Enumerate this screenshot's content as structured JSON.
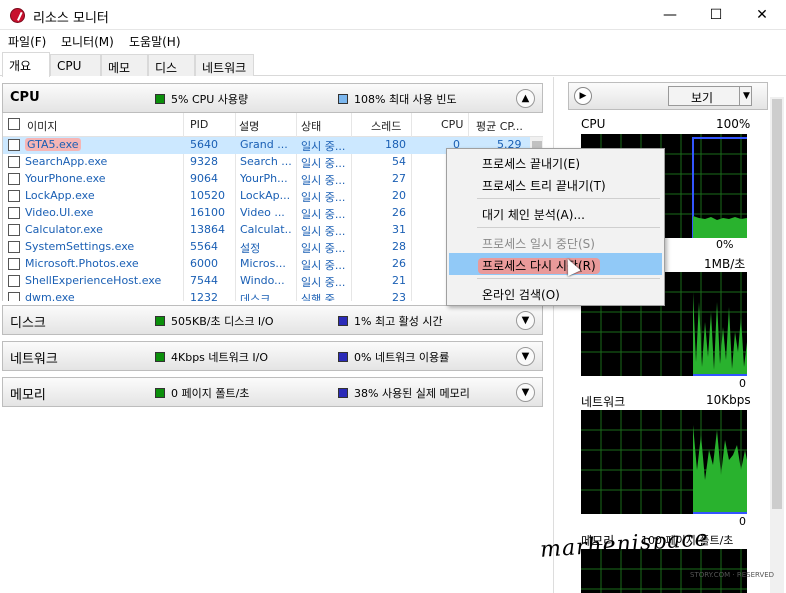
{
  "window": {
    "title": "리소스 모니터",
    "minimize": "—",
    "maximize": "☐",
    "close": "✕"
  },
  "menu": [
    {
      "label": "파일(F)"
    },
    {
      "label": "모니터(M)"
    },
    {
      "label": "도움말(H)"
    }
  ],
  "tabs": [
    {
      "label": "개요"
    },
    {
      "label": "CPU"
    },
    {
      "label": "메모리"
    },
    {
      "label": "디스크"
    },
    {
      "label": "네트워크"
    }
  ],
  "cpu_section": {
    "title": "CPU",
    "legend1": "5% CPU 사용량",
    "legend2": "108% 최대 사용 빈도",
    "columns": {
      "image": "이미지",
      "pid": "PID",
      "desc": "설명",
      "status": "상태",
      "threads": "스레드",
      "cpu": "CPU",
      "avg": "평균 CP..."
    },
    "rows": [
      {
        "image": "GTA5.exe",
        "pid": "5640",
        "desc": "Grand ...",
        "status": "일시 중...",
        "threads": "180",
        "cpu": "0",
        "avg": "5.29"
      },
      {
        "image": "SearchApp.exe",
        "pid": "9328",
        "desc": "Search ...",
        "status": "일시 중...",
        "threads": "54",
        "cpu": "",
        "avg": ""
      },
      {
        "image": "YourPhone.exe",
        "pid": "9064",
        "desc": "YourPh...",
        "status": "일시 중...",
        "threads": "27",
        "cpu": "",
        "avg": ""
      },
      {
        "image": "LockApp.exe",
        "pid": "10520",
        "desc": "LockAp...",
        "status": "일시 중...",
        "threads": "20",
        "cpu": "",
        "avg": ""
      },
      {
        "image": "Video.UI.exe",
        "pid": "16100",
        "desc": "Video ...",
        "status": "일시 중...",
        "threads": "26",
        "cpu": "",
        "avg": ""
      },
      {
        "image": "Calculator.exe",
        "pid": "13864",
        "desc": "Calculat...",
        "status": "일시 중...",
        "threads": "31",
        "cpu": "",
        "avg": ""
      },
      {
        "image": "SystemSettings.exe",
        "pid": "5564",
        "desc": "설정",
        "status": "일시 중...",
        "threads": "28",
        "cpu": "",
        "avg": ""
      },
      {
        "image": "Microsoft.Photos.exe",
        "pid": "6000",
        "desc": "Micros...",
        "status": "일시 중...",
        "threads": "26",
        "cpu": "",
        "avg": ""
      },
      {
        "image": "ShellExperienceHost.exe",
        "pid": "7544",
        "desc": "Windo...",
        "status": "일시 중...",
        "threads": "21",
        "cpu": "",
        "avg": ""
      },
      {
        "image": "dwm.exe",
        "pid": "1232",
        "desc": "데스크...",
        "status": "실행 중",
        "threads": "23",
        "cpu": "",
        "avg": ""
      }
    ]
  },
  "disk_section": {
    "title": "디스크",
    "legend1": "505KB/초 디스크 I/O",
    "legend2": "1% 최고 활성 시간"
  },
  "network_section": {
    "title": "네트워크",
    "legend1": "4Kbps 네트워크 I/O",
    "legend2": "0% 네트워크 이용률"
  },
  "memory_section": {
    "title": "메모리",
    "legend1": "0 페이지 폴트/초",
    "legend2": "38% 사용된 실제 메모리"
  },
  "context_menu": {
    "items": [
      {
        "label": "프로세스 끝내기(E)",
        "state": "normal"
      },
      {
        "label": "프로세스 트리 끝내기(T)",
        "state": "normal"
      },
      {
        "label": "대기 체인 분석(A)...",
        "state": "normal"
      },
      {
        "label": "프로세스 일시 중단(S)",
        "state": "disabled"
      },
      {
        "label": "프로세스 다시 시작(R)",
        "state": "highlighted"
      },
      {
        "label": "온라인 검색(O)",
        "state": "normal"
      }
    ]
  },
  "right_panel": {
    "view_button": "보기",
    "graphs": [
      {
        "label": "CPU",
        "max": "100%",
        "min": "0%"
      },
      {
        "label": "",
        "max": "1MB/초",
        "min": "0"
      },
      {
        "label": "네트워크",
        "max": "10Kbps",
        "min": "0"
      },
      {
        "label": "메모리",
        "max": "100 페이지 폴트/초",
        "min": ""
      }
    ]
  },
  "watermark": {
    "text": "marhenispace",
    "small": "STORY.COM · RESERVED"
  },
  "colors": {
    "accent_green": "#0b8f0b",
    "accent_blue": "#2b2bb8",
    "graph_bg": "#000000",
    "grid": "#1a6b1a",
    "selection": "#cce8ff",
    "menu_highlight": "#91c9f7"
  }
}
